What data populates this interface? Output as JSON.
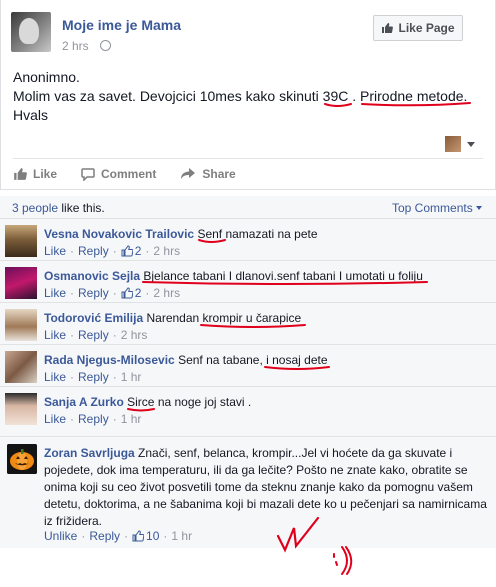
{
  "post": {
    "page_name": "Moje ime je Mama",
    "time": "2 hrs",
    "like_page_label": "Like Page",
    "body_lines": [
      "Anonimno.",
      "Molim vas za savet. Devojcici 10mes kako skinuti 39C . Prirodne metode.",
      "Hvals"
    ],
    "actions": [
      "Like",
      "Comment",
      "Share"
    ]
  },
  "ufi": {
    "likes_count": "3 people",
    "likes_suffix": " like this.",
    "top_comments": "Top Comments"
  },
  "comments": [
    {
      "author": "Vesna Novakovic Trailovic",
      "text": "Senf namazati na pete",
      "like": "Like",
      "reply": "Reply",
      "likes": "2",
      "time": "2 hrs"
    },
    {
      "author": "Osmanovic Sejla",
      "text": "Bjelance tabani I dlanovi.senf tabani I umotati u foliju",
      "like": "Like",
      "reply": "Reply",
      "likes": "2",
      "time": "2 hrs"
    },
    {
      "author": "Todorović Emilija",
      "text": "Narendan krompir u čarapice",
      "like": "Like",
      "reply": "Reply",
      "time": "2 hrs"
    },
    {
      "author": "Rada Njegus-Milosevic",
      "text": "Senf na tabane, i nosaj dete",
      "like": "Like",
      "reply": "Reply",
      "time": "1 hr"
    },
    {
      "author": "Sanja A Zurko",
      "text": "Sirce na noge joj stavi .",
      "like": "Like",
      "reply": "Reply",
      "time": "1 hr"
    }
  ],
  "reply_comment": {
    "author": "Zoran Savrljuga",
    "text": "Znači, senf, belanca, krompir...Jel vi hoćete da ga skuvate i pojedete, dok ima temperaturu, ili da ga lečite? Pošto ne znate kako, obratite se onima koji su ceo život posvetili tome da steknu znanje kako da pomognu vašem detetu, doktorima, a ne šabanima koji bi mazali dete ko u pečenjari sa namirnicama iz frižidera.",
    "unlike": "Unlike",
    "reply": "Reply",
    "likes": "10",
    "time": "1 hr"
  },
  "colors": {
    "link": "#3b5998",
    "annotation_red": "#e0001b"
  },
  "icons": [
    "globe-icon",
    "thumbs-up-icon",
    "comment-icon",
    "share-icon",
    "caret-down-icon",
    "pumpkin-icon"
  ]
}
